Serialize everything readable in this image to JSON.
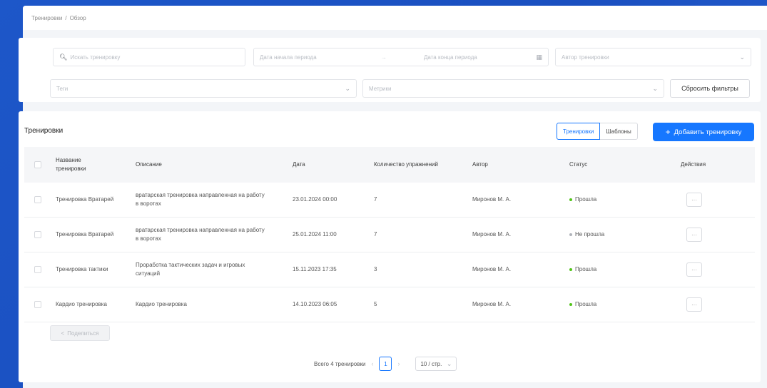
{
  "breadcrumb": [
    "Тренировки",
    "Обзор"
  ],
  "breadcrumb_sep": "/",
  "filters": {
    "search_placeholder": "Искать тренировку",
    "date_start_placeholder": "Дата начала периода",
    "date_end_placeholder": "Дата конца периода",
    "date_sep": "→",
    "author_placeholder": "Автор тренировки",
    "tags_placeholder": "Теги",
    "metrics_placeholder": "Метрики",
    "reset_label": "Сбросить фильтры"
  },
  "card": {
    "title": "Тренировки",
    "tabs": [
      "Тренировки",
      "Шаблоны"
    ],
    "add_label": "Добавить тренировку"
  },
  "table": {
    "columns": [
      "Название тренировки",
      "Описание",
      "Дата",
      "Количество упражнений",
      "Автор",
      "Статус",
      "Действия"
    ],
    "rows": [
      {
        "name": "Тренировка Вратарей",
        "description": "вратарская тренировка направленная на работу в воротах",
        "date": "23.01.2024 00:00",
        "count": "7",
        "author": "Миронов М. А.",
        "status": "Прошла",
        "status_key": "done"
      },
      {
        "name": "Тренировка Вратарей",
        "description": "вратарская тренировка направленная на работу в воротах",
        "date": "25.01.2024 11:00",
        "count": "7",
        "author": "Миронов М. А.",
        "status": "Не прошла",
        "status_key": "pending"
      },
      {
        "name": "Тренировка тактики",
        "description": "Проработка тактических задач и игровых ситуаций",
        "date": "15.11.2023 17:35",
        "count": "3",
        "author": "Миронов М. А.",
        "status": "Прошла",
        "status_key": "done"
      },
      {
        "name": "Кардио тренировка",
        "description": "Кардио тренировка",
        "date": "14.10.2023 06:05",
        "count": "5",
        "author": "Миронов М. А.",
        "status": "Прошла",
        "status_key": "done"
      }
    ],
    "action_label": "···"
  },
  "share_label": "Поделиться",
  "pagination": {
    "total_label": "Всего 4 тренировки",
    "current_page": "1",
    "page_size": "10 / стр."
  },
  "icons": {
    "search": "magnifier-icon",
    "calendar": "calendar-icon",
    "chevron": "chevron-down-icon",
    "plus": "plus-icon",
    "share": "share-icon"
  },
  "colors": {
    "primary": "#1677ff",
    "status_done": "#52c41a",
    "status_pending": "#b0b4ba",
    "background": "#1d57c9"
  }
}
